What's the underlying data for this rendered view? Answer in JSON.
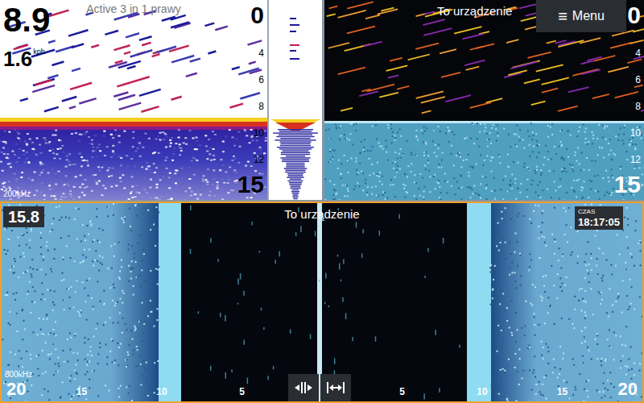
{
  "sonar": {
    "title": "Active 3 in 1 prawy",
    "depth": "8.9",
    "speed": "1.6",
    "speed_unit": "kph",
    "frequency": "200kHz",
    "scale": [
      {
        "label": "0",
        "kind": "major"
      },
      {
        "label": "4",
        "kind": "minor"
      },
      {
        "label": "6",
        "kind": "minor"
      },
      {
        "label": "8",
        "kind": "minor"
      },
      {
        "label": "10",
        "kind": "minor"
      },
      {
        "label": "12",
        "kind": "minor"
      },
      {
        "label": "15",
        "kind": "major"
      }
    ]
  },
  "downscan": {
    "title": "To urządzenie",
    "menu": {
      "icon": "≡",
      "label": "Menu"
    },
    "scale": [
      {
        "label": "0",
        "kind": "major"
      },
      {
        "label": "4",
        "kind": "minor"
      },
      {
        "label": "6",
        "kind": "minor"
      },
      {
        "label": "8",
        "kind": "minor"
      },
      {
        "label": "10",
        "kind": "minor"
      },
      {
        "label": "12",
        "kind": "minor"
      },
      {
        "label": "15",
        "kind": "major"
      }
    ]
  },
  "sidescan": {
    "title": "To urządzenie",
    "range": "15.8",
    "time_label": "CZAS",
    "time": "18:17:05",
    "frequency": "800kHz",
    "scale": [
      {
        "label": "20",
        "side": "left",
        "kind": "major"
      },
      {
        "label": "15",
        "side": "left",
        "kind": "minor"
      },
      {
        "label": "10",
        "side": "left",
        "kind": "minor"
      },
      {
        "label": "5",
        "side": "left",
        "kind": "minor"
      },
      {
        "label": "5",
        "side": "right",
        "kind": "minor"
      },
      {
        "label": "10",
        "side": "right",
        "kind": "minor"
      },
      {
        "label": "15",
        "side": "right",
        "kind": "minor"
      },
      {
        "label": "20",
        "side": "right",
        "kind": "major"
      }
    ]
  }
}
